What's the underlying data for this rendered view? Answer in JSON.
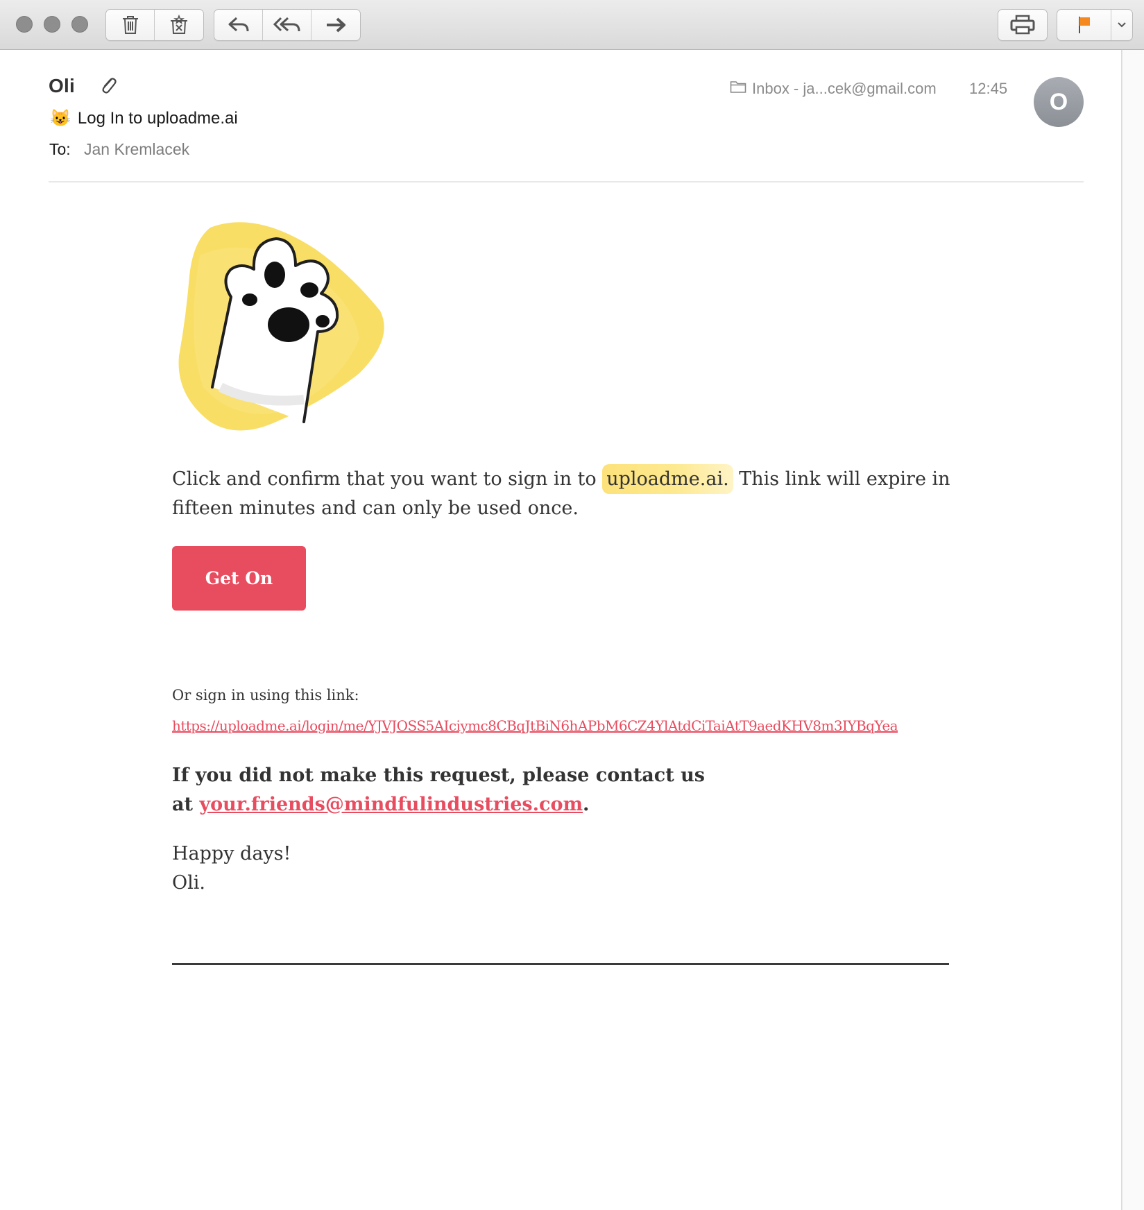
{
  "window": {
    "controls": [
      "close",
      "minimize",
      "zoom"
    ]
  },
  "toolbar": {
    "left_group_1": [
      {
        "name": "trash-icon",
        "tooltip": "Delete"
      },
      {
        "name": "junk-icon",
        "tooltip": "Junk"
      }
    ],
    "left_group_2": [
      {
        "name": "reply-icon",
        "tooltip": "Reply"
      },
      {
        "name": "reply-all-icon",
        "tooltip": "Reply All"
      },
      {
        "name": "forward-icon",
        "tooltip": "Forward"
      }
    ],
    "right": [
      {
        "name": "print-icon"
      },
      {
        "name": "flag-icon",
        "color": "#f5891f"
      },
      {
        "name": "chevron-down-icon"
      }
    ]
  },
  "header": {
    "sender": "Oli",
    "has_attachment": true,
    "subject_emoji": "😺",
    "subject": "Log In to uploadme.ai",
    "to_label": "To:",
    "to_value": "Jan Kremlacek",
    "mailbox": "Inbox - ja...cek@gmail.com",
    "time": "12:45",
    "avatar_initial": "O"
  },
  "body": {
    "intro_before": "Click and confirm that you want to sign in to ",
    "intro_highlight": "uploadme.ai.",
    "intro_after": " This link will expire in fifteen minutes and can only be used once.",
    "cta_label": "Get On",
    "alt_label": "Or sign in using this link:",
    "alt_url": "https://uploadme.ai/login/me/YJVJOSS5AIciymc8CBqJtBiN6hAPbM6CZ4YlAtdCiTaiAtT9aedKHV8m3IYBqYea",
    "warning_text": "If you did not make this request, please contact us at ",
    "warning_email": "your.friends@mindfulindustries.com",
    "warning_end": ".",
    "signoff_line1": "Happy days!",
    "signoff_line2": "Oli."
  },
  "colors": {
    "accent": "#e84c5f",
    "highlight": "#fde27a",
    "flag": "#f5891f",
    "avatar": "#9ba0a6"
  }
}
